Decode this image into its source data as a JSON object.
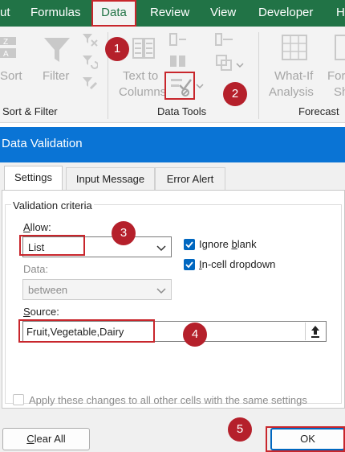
{
  "ribbon": {
    "tabs": [
      "ut",
      "Formulas",
      "Data",
      "Review",
      "View",
      "Developer",
      "H"
    ],
    "active_tab": "Data",
    "buttons": {
      "sort": "Sort",
      "filter": "Filter",
      "text_to_columns_line1": "Text to",
      "text_to_columns_line2": "Columns",
      "what_if_line1": "What-If",
      "what_if_line2": "Analysis",
      "forecast_line1": "Fore",
      "forecast_line2": "Sh"
    },
    "groups": {
      "sort_filter": "Sort & Filter",
      "data_tools": "Data Tools",
      "forecast": "Forecast"
    }
  },
  "steps": [
    "1",
    "2",
    "3",
    "4",
    "5"
  ],
  "dialog": {
    "title": "Data Validation",
    "tabs": [
      "Settings",
      "Input Message",
      "Error Alert"
    ],
    "active_tab": "Settings",
    "group_label": "Validation criteria",
    "allow": {
      "label_u": "A",
      "label_rest": "llow:",
      "value": "List"
    },
    "ignore_blank": {
      "label_pre": "Ignore ",
      "label_u": "b",
      "label_post": "lank",
      "checked": true
    },
    "in_cell_dropdown": {
      "label_u": "I",
      "label_rest": "n-cell dropdown",
      "checked": true
    },
    "data": {
      "label": "Data:",
      "value": "between"
    },
    "source": {
      "label_u": "S",
      "label_rest": "ource:",
      "value": "Fruit,Vegetable,Dairy"
    },
    "apply_all": {
      "label": "Apply these changes to all other cells with the same settings",
      "checked": false
    },
    "clear_all": {
      "label_u": "C",
      "label_rest": "lear All"
    },
    "ok": "OK"
  },
  "colors": {
    "ribbon_green": "#217346",
    "title_blue": "#0a74d5",
    "highlight_red": "#c8262c",
    "badge_red": "#b5202b",
    "check_blue": "#0067c0"
  }
}
